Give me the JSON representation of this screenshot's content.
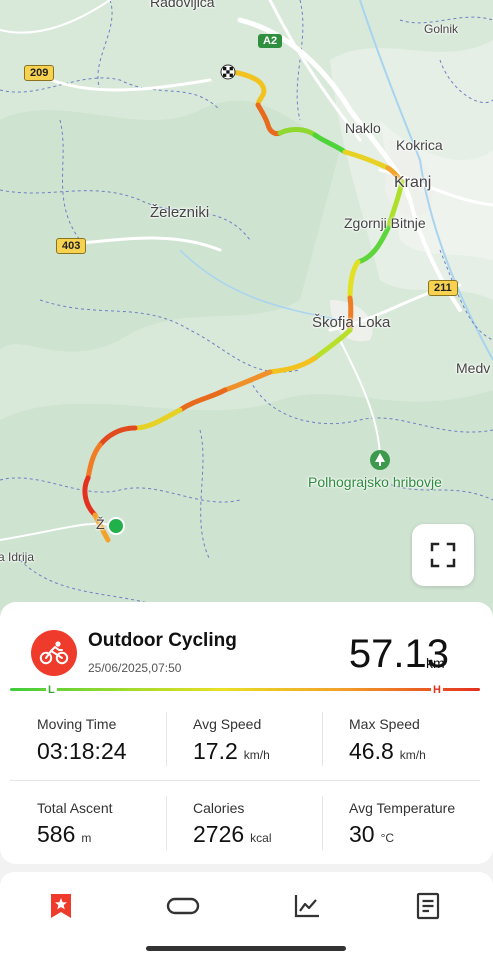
{
  "map": {
    "places": {
      "radovljica": "Radovljica",
      "golnik": "Golnik",
      "naklo": "Naklo",
      "kokrica": "Kokrica",
      "kranj": "Kranj",
      "zelezniki": "Železniki",
      "zgornji_bitnje": "Zgornji Bitnje",
      "skofja_loka": "Škofja Loka",
      "medv": "Medv",
      "polhograjsko": "Polhograjsko hribovje",
      "idrija": "a Idrija",
      "z": "Ž"
    },
    "roads": {
      "a2": "A2",
      "r209": "209",
      "r403": "403",
      "r211": "211"
    }
  },
  "activity": {
    "type": "Outdoor Cycling",
    "datetime": "25/06/2025,07:50",
    "distance": "57.13",
    "distance_unit": "km"
  },
  "scale": {
    "low": "L",
    "high": "H"
  },
  "stats": {
    "moving_time": {
      "label": "Moving Time",
      "value": "03:18:24",
      "unit": ""
    },
    "avg_speed": {
      "label": "Avg Speed",
      "value": "17.2",
      "unit": "km/h"
    },
    "max_speed": {
      "label": "Max Speed",
      "value": "46.8",
      "unit": "km/h"
    },
    "total_ascent": {
      "label": "Total Ascent",
      "value": "586",
      "unit": "m"
    },
    "calories": {
      "label": "Calories",
      "value": "2726",
      "unit": "kcal"
    },
    "avg_temperature": {
      "label": "Avg Temperature",
      "value": "30",
      "unit": "°C"
    }
  },
  "colors": {
    "accent": "#ef3b2c",
    "start_marker": "#22b04a",
    "scale_low": "#3ecc3e",
    "scale_high": "#e4301e"
  },
  "nav": {
    "items": [
      "bookmark-icon",
      "route-icon",
      "chart-icon",
      "details-icon"
    ],
    "active": "bookmark-icon"
  }
}
